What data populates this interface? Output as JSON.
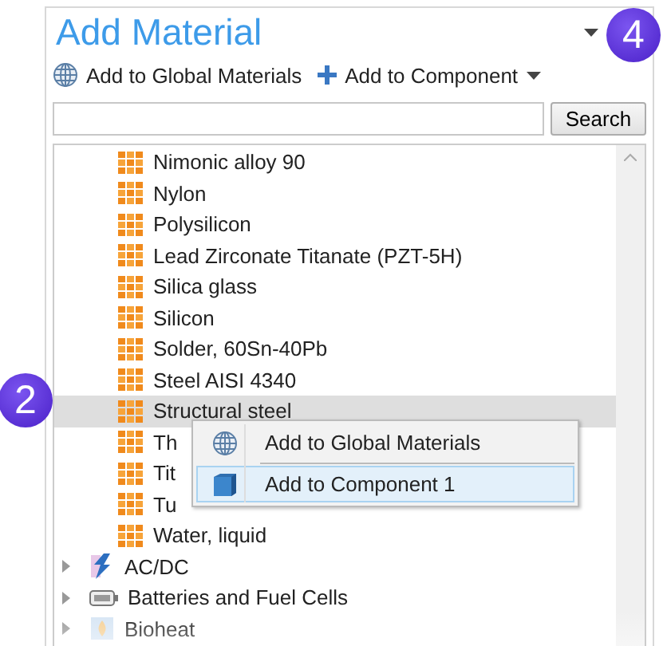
{
  "panel": {
    "title": "Add Material",
    "toolbar": [
      {
        "kind": "globe",
        "label": "Add to Global Materials",
        "dropdown": false
      },
      {
        "kind": "plus",
        "label": "Add to Component",
        "dropdown": true
      }
    ],
    "search": {
      "button": "Search"
    },
    "tree": [
      {
        "kind": "material",
        "label": "Nimonic alloy 90",
        "selected": false
      },
      {
        "kind": "material",
        "label": "Nylon",
        "selected": false
      },
      {
        "kind": "material",
        "label": "Polysilicon",
        "selected": false
      },
      {
        "kind": "material",
        "label": "Lead Zirconate Titanate (PZT-5H)",
        "selected": false
      },
      {
        "kind": "material",
        "label": "Silica glass",
        "selected": false
      },
      {
        "kind": "material",
        "label": "Silicon",
        "selected": false
      },
      {
        "kind": "material",
        "label": "Solder, 60Sn-40Pb",
        "selected": false
      },
      {
        "kind": "material",
        "label": "Steel AISI 4340",
        "selected": false
      },
      {
        "kind": "material",
        "label": "Structural steel",
        "selected": true
      },
      {
        "kind": "material",
        "label": "Th",
        "selected": false
      },
      {
        "kind": "material",
        "label": "Tit",
        "selected": false
      },
      {
        "kind": "material",
        "label": "Tu",
        "selected": false
      },
      {
        "kind": "material",
        "label": "Water, liquid",
        "selected": false
      },
      {
        "kind": "category",
        "label": "AC/DC",
        "selected": false,
        "expanded": false
      },
      {
        "kind": "category",
        "label": "Batteries and Fuel Cells",
        "selected": false,
        "expanded": false
      },
      {
        "kind": "category",
        "label": "Bioheat",
        "selected": false,
        "expanded": false
      }
    ],
    "context_menu": [
      {
        "kind": "globe",
        "label": "Add to Global Materials",
        "selected": false
      },
      {
        "kind": "cube",
        "label": "Add to Component 1",
        "selected": true
      }
    ]
  },
  "callouts": [
    {
      "label": "4"
    },
    {
      "label": "2"
    }
  ]
}
